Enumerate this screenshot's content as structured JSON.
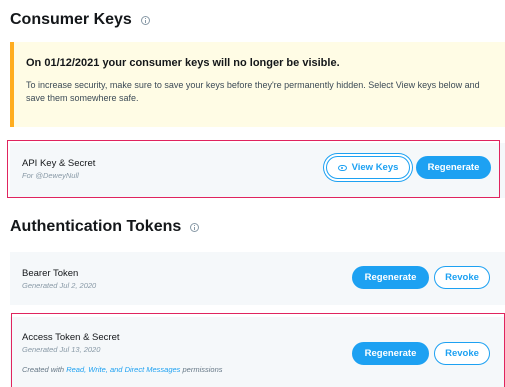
{
  "consumer_keys": {
    "title": "Consumer Keys",
    "notice": {
      "title": "On 01/12/2021 your consumer keys will no longer be visible.",
      "body": "To increase security, make sure to save your keys before they're permanently hidden. Select View keys below and save them somewhere safe."
    },
    "api_key": {
      "title": "API Key & Secret",
      "subtitle": "For @DeweyNull",
      "view_label": "View Keys",
      "regenerate_label": "Regenerate"
    }
  },
  "auth_tokens": {
    "title": "Authentication Tokens",
    "bearer": {
      "title": "Bearer Token",
      "subtitle": "Generated Jul 2, 2020",
      "regenerate_label": "Regenerate",
      "revoke_label": "Revoke"
    },
    "access": {
      "title": "Access Token & Secret",
      "subtitle": "Generated Jul 13, 2020",
      "perm_prefix": "Created with",
      "perm_link": "Read, Write, and Direct Messages",
      "perm_suffix": "permissions",
      "regenerate_label": "Regenerate",
      "revoke_label": "Revoke"
    }
  },
  "colors": {
    "accent": "#1da1f2",
    "notice_bg": "#fffce5",
    "notice_border": "#ffad1f",
    "highlight": "#e0245e",
    "row_bg": "#f5f8fa"
  },
  "icons": [
    "info-icon",
    "eye-icon"
  ]
}
